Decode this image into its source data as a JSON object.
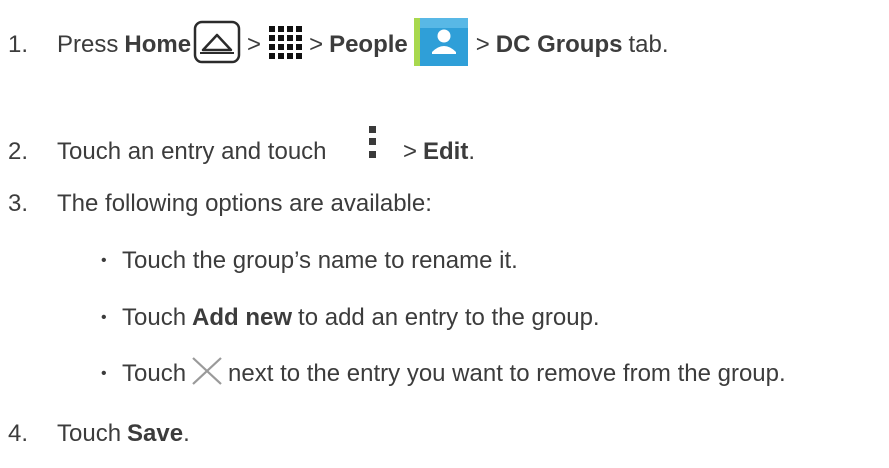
{
  "steps": [
    {
      "number": "1.",
      "parts": {
        "press": "Press",
        "home": "Home",
        "gt1": ">",
        "gt2": ">",
        "people": "People",
        "gt3": ">",
        "dc_groups": "DC Groups",
        "tab": "tab."
      }
    },
    {
      "number": "2.",
      "parts": {
        "touch_entry": "Touch an entry and touch",
        "gt": ">",
        "edit": "Edit",
        "period": "."
      }
    },
    {
      "number": "3.",
      "text": "The following options are available:"
    },
    {
      "number": "4.",
      "parts": {
        "touch": "Touch",
        "save": "Save",
        "period": "."
      }
    }
  ],
  "bullets": [
    {
      "dot": "•",
      "text": "Touch the group’s name to rename it."
    },
    {
      "dot": "•",
      "touch": "Touch",
      "bold": "Add new",
      "rest": "to add an entry to the group."
    },
    {
      "dot": "•",
      "touch": "Touch",
      "rest": "next to the entry you want to remove from the group."
    }
  ],
  "icons": {
    "home": "home-icon",
    "apps": "apps-grid-icon",
    "people": "people-app-icon",
    "menu": "menu-overflow-icon",
    "remove": "close-x-icon"
  },
  "colors": {
    "text": "#3c3c3c",
    "people_icon_bg": "#2f9fd8"
  }
}
